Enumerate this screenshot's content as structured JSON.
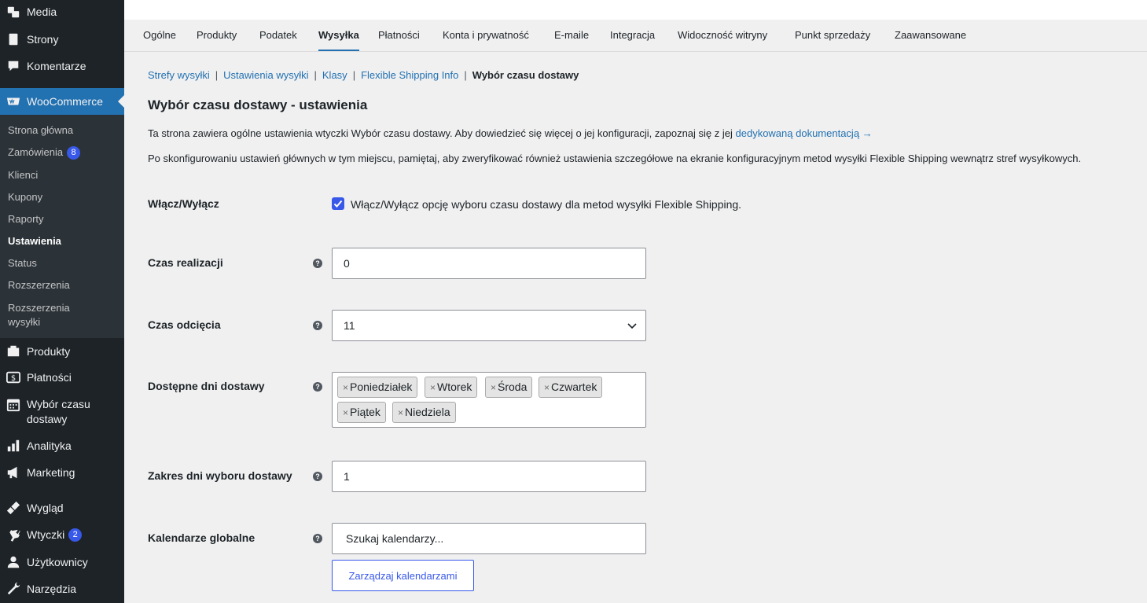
{
  "sidebar": {
    "items": [
      {
        "label": "Media",
        "icon": "media-icon"
      },
      {
        "label": "Strony",
        "icon": "pages-icon"
      },
      {
        "label": "Komentarze",
        "icon": "comments-icon"
      },
      {
        "label": "WooCommerce",
        "icon": "woocommerce-icon"
      },
      {
        "label": "Produkty",
        "icon": "products-icon"
      },
      {
        "label": "Płatności",
        "icon": "payments-icon"
      },
      {
        "label": "Wybór czasu dostawy",
        "icon": "calendar-icon"
      },
      {
        "label": "Analityka",
        "icon": "analytics-icon"
      },
      {
        "label": "Marketing",
        "icon": "megaphone-icon"
      },
      {
        "label": "Wygląd",
        "icon": "appearance-icon"
      },
      {
        "label": "Wtyczki",
        "icon": "plugins-icon",
        "badge": "2"
      },
      {
        "label": "Użytkownicy",
        "icon": "users-icon"
      },
      {
        "label": "Narzędzia",
        "icon": "tools-icon"
      }
    ],
    "woo_submenu": [
      {
        "label": "Strona główna"
      },
      {
        "label": "Zamówienia",
        "badge": "8"
      },
      {
        "label": "Klienci"
      },
      {
        "label": "Kupony"
      },
      {
        "label": "Raporty"
      },
      {
        "label": "Ustawienia",
        "current": true
      },
      {
        "label": "Status"
      },
      {
        "label": "Rozszerzenia"
      },
      {
        "label": "Rozszerzenia wysyłki"
      }
    ]
  },
  "tabs": [
    "Ogólne",
    "Produkty",
    "Podatek",
    "Wysyłka",
    "Płatności",
    "Konta i prywatność",
    "E-maile",
    "Integracja",
    "Widoczność witryny",
    "Punkt sprzedaży",
    "Zaawansowane"
  ],
  "active_tab": "Wysyłka",
  "subnav": {
    "links": [
      "Strefy wysyłki",
      "Ustawienia wysyłki",
      "Klasy",
      "Flexible Shipping Info"
    ],
    "current": "Wybór czasu dostawy",
    "separator": "|"
  },
  "page": {
    "title": "Wybór czasu dostawy - ustawienia",
    "desc1": "Ta strona zawiera ogólne ustawienia wtyczki Wybór czasu dostawy. Aby dowiedzieć się więcej o jej konfiguracji, zapoznaj się z jej ",
    "desc1_link": "dedykowaną dokumentacją →",
    "desc2": "Po skonfigurowaniu ustawień głównych w tym miejscu, pamiętaj, aby zweryfikować również ustawienia szczegółowe na ekranie konfiguracyjnym metod wysyłki Flexible Shipping wewnątrz stref wysyłkowych."
  },
  "form": {
    "enable": {
      "label": "Włącz/Wyłącz",
      "checkbox_label": "Włącz/Wyłącz opcję wyboru czasu dostawy dla metod wysyłki Flexible Shipping.",
      "checked": true
    },
    "processing_time": {
      "label": "Czas realizacji",
      "value": "0"
    },
    "cutoff_time": {
      "label": "Czas odcięcia",
      "value": "11"
    },
    "delivery_days": {
      "label": "Dostępne dni dostawy",
      "remove_glyph": "×",
      "chips": [
        "Poniedziałek",
        "Wtorek",
        "Środa",
        "Czwartek",
        "Piątek",
        "Niedziela"
      ]
    },
    "range": {
      "label": "Zakres dni wyboru dostawy",
      "value": "1"
    },
    "calendars": {
      "label": "Kalendarze globalne",
      "placeholder": "Szukaj kalendarzy...",
      "manage_button": "Zarządzaj kalendarzami"
    },
    "help_glyph": "?"
  },
  "colors": {
    "sidebar_bg": "#1d2327",
    "submenu_bg": "#2c3338",
    "active_menu": "#2271b1",
    "link": "#2271b1",
    "accent": "#3858e9"
  }
}
